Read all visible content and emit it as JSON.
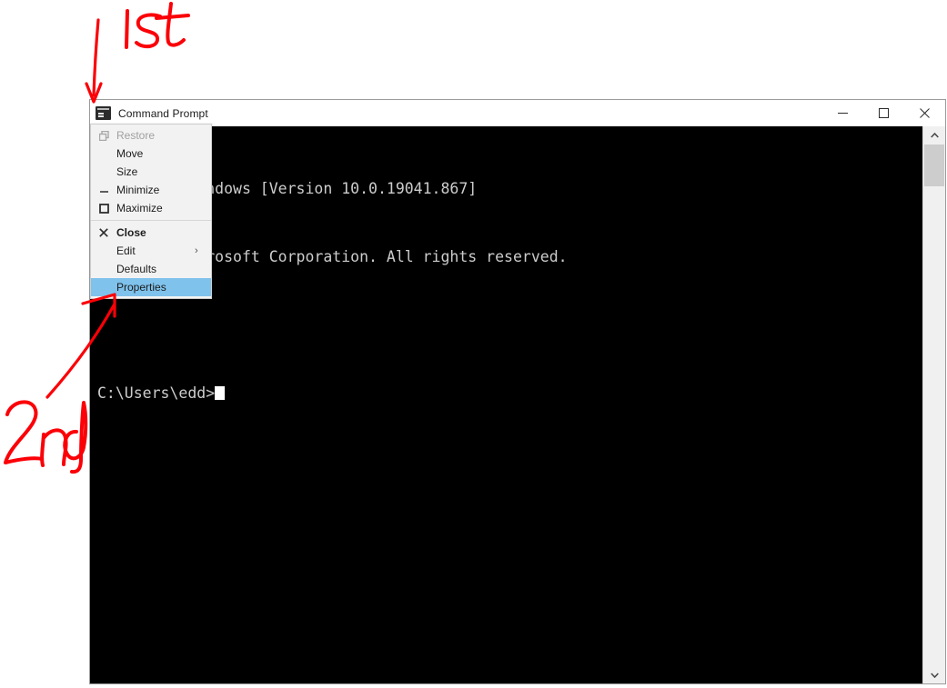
{
  "window": {
    "title": "Command Prompt",
    "icon": "console-icon",
    "caption_buttons": [
      {
        "name": "minimize",
        "label": "—"
      },
      {
        "name": "maximize",
        "label": "□"
      },
      {
        "name": "close",
        "label": "✕"
      }
    ]
  },
  "terminal": {
    "lines": [
      "Microsoft Windows [Version 10.0.19041.867]",
      "(c) 2020 Microsoft Corporation. All rights reserved.",
      "",
      "C:\\Users\\edd>"
    ],
    "visible_text_right_of_menu": [
      "ndows [Version 10.0.19041.867]",
      "rosoft Corporation. All rights reserved.",
      "",
      "edd>"
    ],
    "cursor": "block",
    "background": "#000000",
    "foreground": "#cccccc"
  },
  "scrollbar": {
    "up_arrow": "chevron-up-icon",
    "down_arrow": "chevron-down-icon",
    "thumb_position": "top"
  },
  "system_menu": {
    "highlight_color": "#7fc2ec",
    "items": [
      {
        "id": "restore",
        "label": "Restore",
        "icon": "restore-icon",
        "disabled": true,
        "bold": false,
        "selected": false,
        "submenu": false
      },
      {
        "id": "move",
        "label": "Move",
        "icon": "",
        "disabled": false,
        "bold": false,
        "selected": false,
        "submenu": false
      },
      {
        "id": "size",
        "label": "Size",
        "icon": "",
        "disabled": false,
        "bold": false,
        "selected": false,
        "submenu": false
      },
      {
        "id": "minimize",
        "label": "Minimize",
        "icon": "minimize-icon",
        "disabled": false,
        "bold": false,
        "selected": false,
        "submenu": false
      },
      {
        "id": "maximize",
        "label": "Maximize",
        "icon": "maximize-icon",
        "disabled": false,
        "bold": false,
        "selected": false,
        "submenu": false
      },
      {
        "id": "separator",
        "label": "",
        "icon": "",
        "disabled": false,
        "bold": false,
        "selected": false,
        "submenu": false
      },
      {
        "id": "close",
        "label": "Close",
        "icon": "close-icon",
        "disabled": false,
        "bold": true,
        "selected": false,
        "submenu": false
      },
      {
        "id": "edit",
        "label": "Edit",
        "icon": "",
        "disabled": false,
        "bold": false,
        "selected": false,
        "submenu": true
      },
      {
        "id": "defaults",
        "label": "Defaults",
        "icon": "",
        "disabled": false,
        "bold": false,
        "selected": false,
        "submenu": false
      },
      {
        "id": "properties",
        "label": "Properties",
        "icon": "",
        "disabled": false,
        "bold": false,
        "selected": true,
        "submenu": false
      }
    ]
  },
  "annotations": {
    "color": "#fb0007",
    "first": {
      "label": "1st",
      "points_to": "window-icon"
    },
    "second": {
      "label": "2nd",
      "points_to": "menu-item-properties"
    }
  }
}
